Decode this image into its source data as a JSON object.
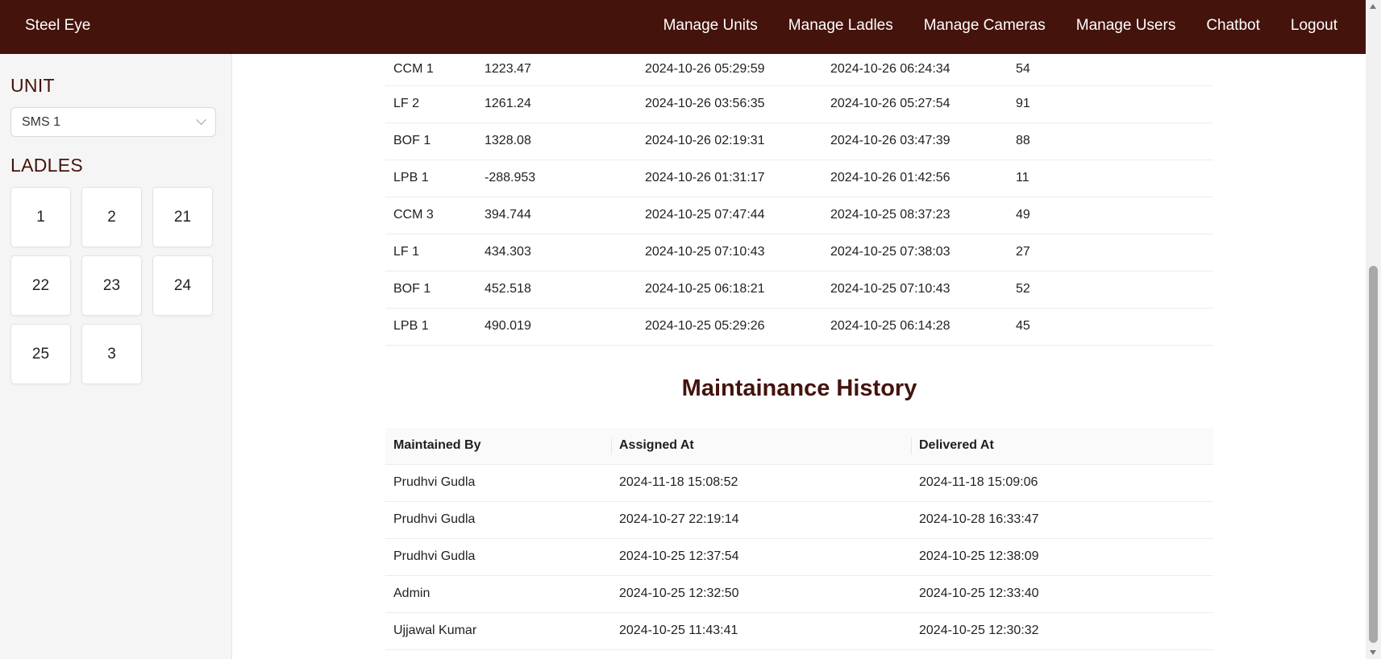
{
  "navbar": {
    "brand": "Steel Eye",
    "items": [
      "Manage Units",
      "Manage Ladles",
      "Manage Cameras",
      "Manage Users",
      "Chatbot",
      "Logout"
    ]
  },
  "sidebar": {
    "unit_heading": "UNIT",
    "unit_selected": "SMS 1",
    "ladles_heading": "LADLES",
    "ladles": [
      "1",
      "2",
      "21",
      "22",
      "23",
      "24",
      "25",
      "3"
    ]
  },
  "trips": {
    "rows": [
      [
        "CCM 1",
        "1223.47",
        "2024-10-26 05:29:59",
        "2024-10-26 06:24:34",
        "54"
      ],
      [
        "LF 2",
        "1261.24",
        "2024-10-26 03:56:35",
        "2024-10-26 05:27:54",
        "91"
      ],
      [
        "BOF 1",
        "1328.08",
        "2024-10-26 02:19:31",
        "2024-10-26 03:47:39",
        "88"
      ],
      [
        "LPB 1",
        "-288.953",
        "2024-10-26 01:31:17",
        "2024-10-26 01:42:56",
        "11"
      ],
      [
        "CCM 3",
        "394.744",
        "2024-10-25 07:47:44",
        "2024-10-25 08:37:23",
        "49"
      ],
      [
        "LF 1",
        "434.303",
        "2024-10-25 07:10:43",
        "2024-10-25 07:38:03",
        "27"
      ],
      [
        "BOF 1",
        "452.518",
        "2024-10-25 06:18:21",
        "2024-10-25 07:10:43",
        "52"
      ],
      [
        "LPB 1",
        "490.019",
        "2024-10-25 05:29:26",
        "2024-10-25 06:14:28",
        "45"
      ]
    ]
  },
  "maintenance": {
    "title": "Maintainance History",
    "headers": [
      "Maintained By",
      "Assigned At",
      "Delivered At"
    ],
    "rows": [
      [
        "Prudhvi Gudla",
        "2024-11-18 15:08:52",
        "2024-11-18 15:09:06"
      ],
      [
        "Prudhvi Gudla",
        "2024-10-27 22:19:14",
        "2024-10-28 16:33:47"
      ],
      [
        "Prudhvi Gudla",
        "2024-10-25 12:37:54",
        "2024-10-25 12:38:09"
      ],
      [
        "Admin",
        "2024-10-25 12:32:50",
        "2024-10-25 12:33:40"
      ],
      [
        "Ujjawal Kumar",
        "2024-10-25 11:43:41",
        "2024-10-25 12:30:32"
      ]
    ]
  },
  "colors": {
    "brand": "#44130c",
    "sidebar_bg": "#f5f5f5"
  }
}
